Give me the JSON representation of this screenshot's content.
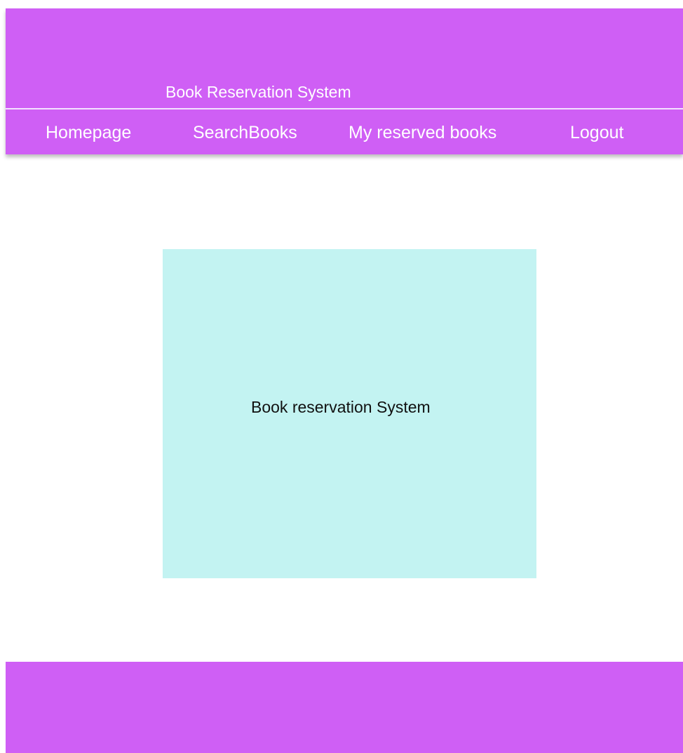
{
  "header": {
    "title": "Book Reservation System"
  },
  "nav": {
    "homepage": "Homepage",
    "search_books": "SearchBooks",
    "reserved_books": "My reserved books",
    "logout": "Logout"
  },
  "main": {
    "hero_text": "Book reservation System"
  },
  "colors": {
    "header_background": "#cf5ff5",
    "hero_background": "#c3f3f2",
    "footer_background": "#cf5ff5"
  }
}
